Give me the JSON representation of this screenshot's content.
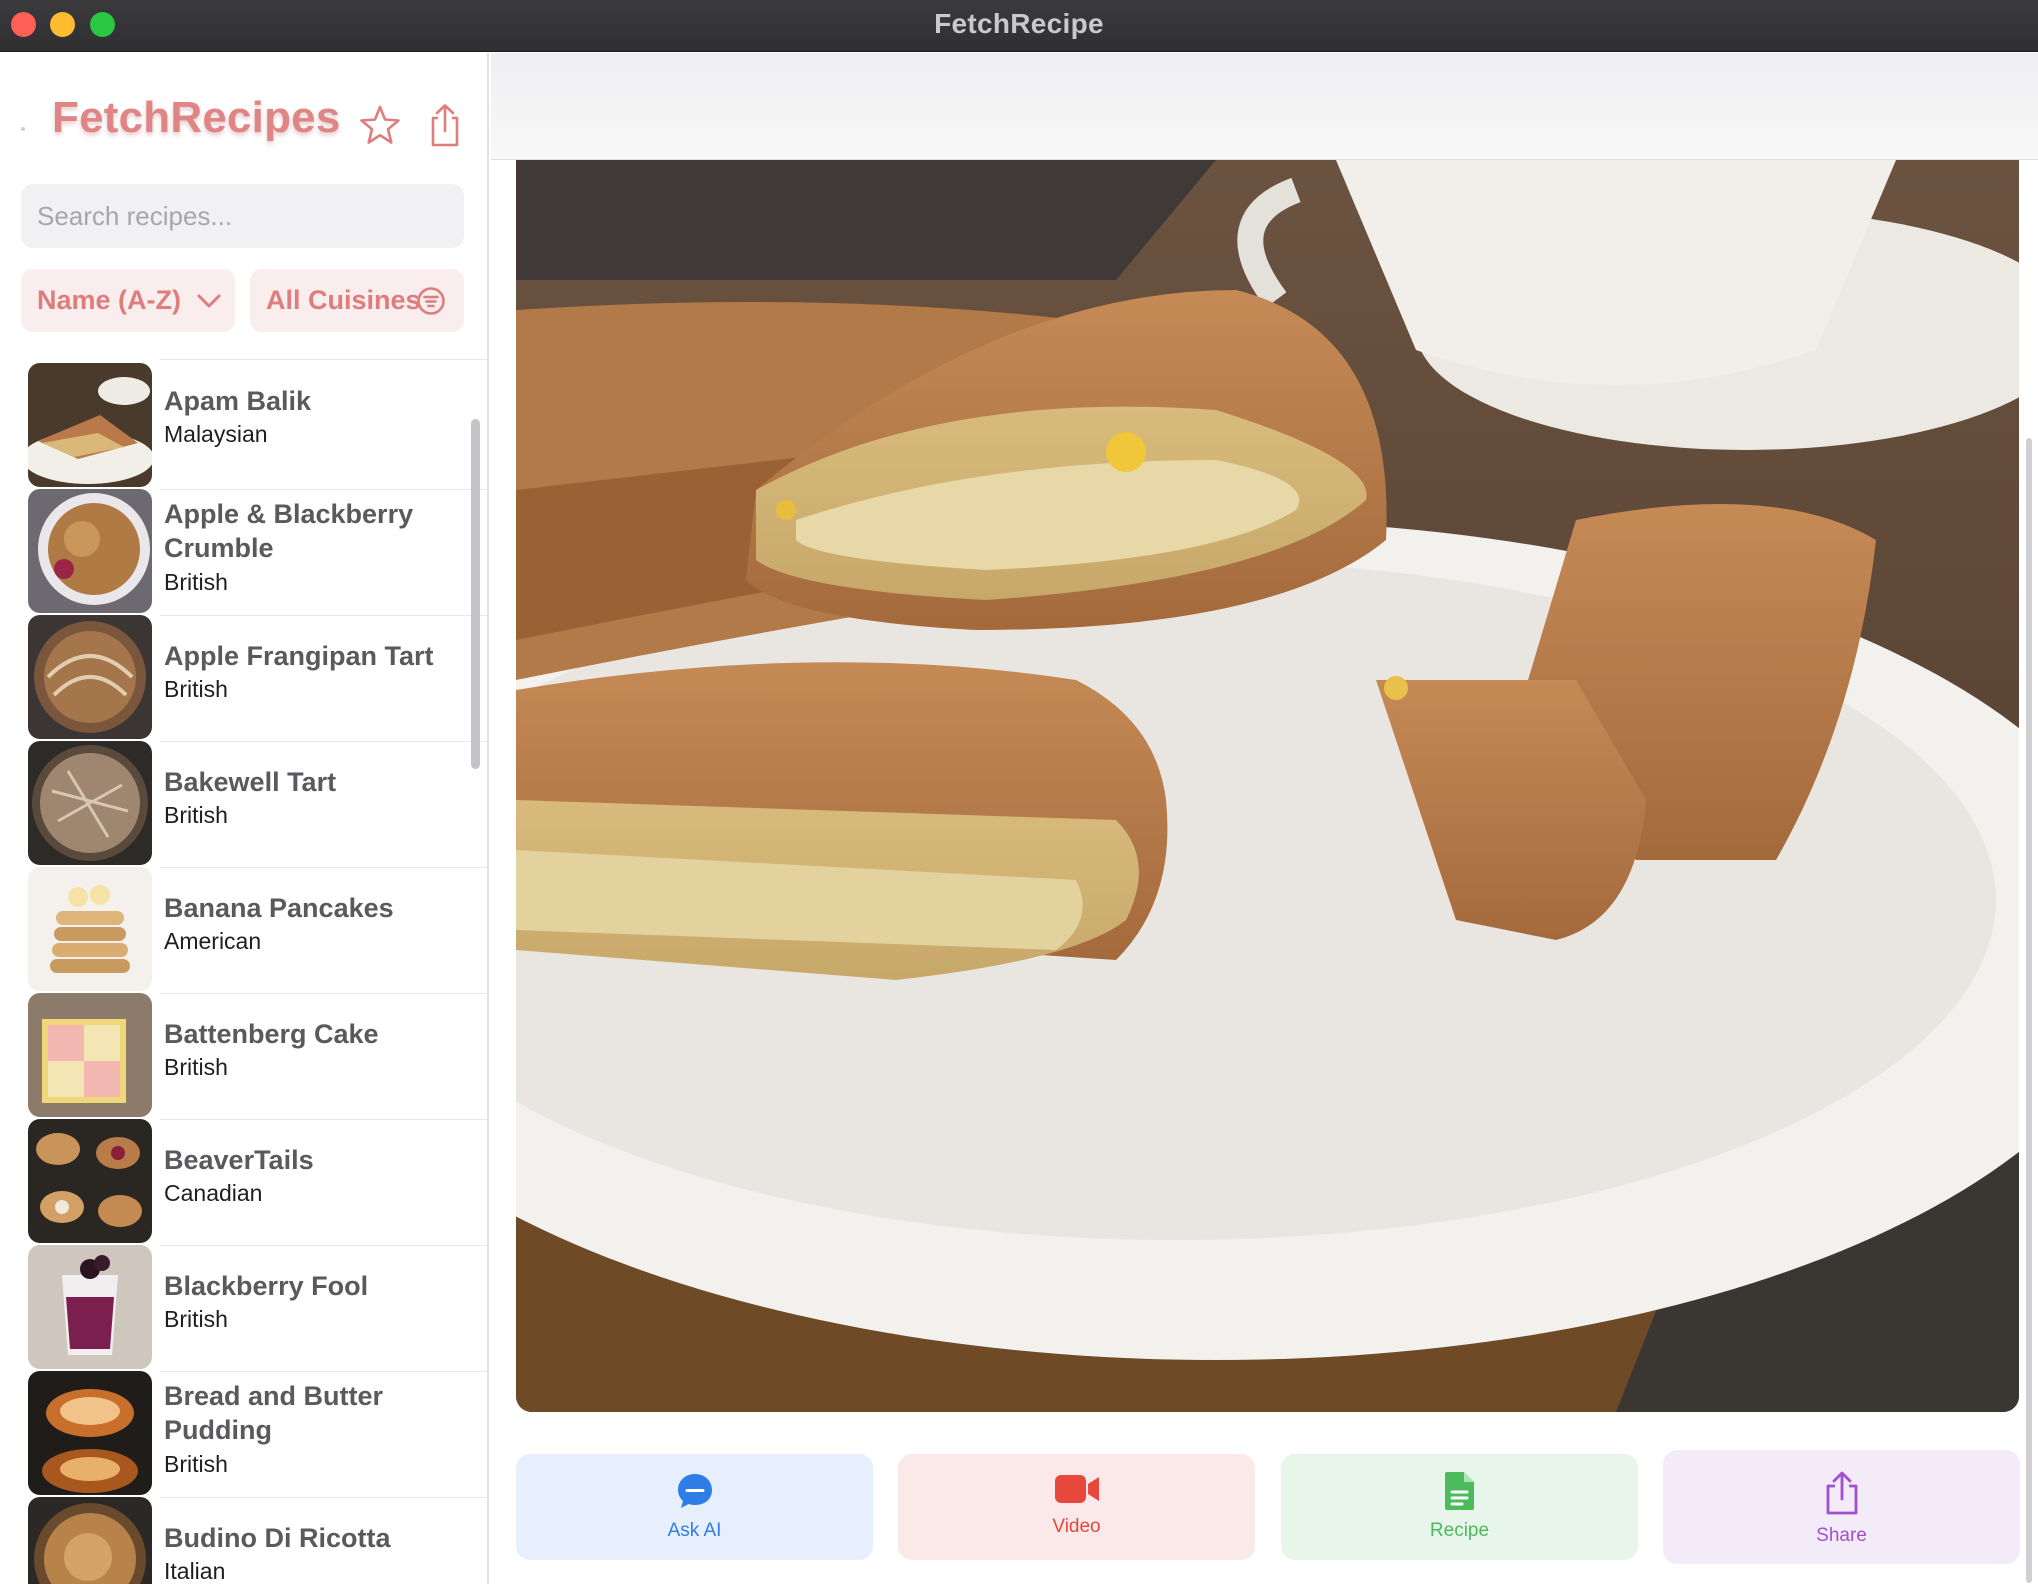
{
  "window": {
    "title": "FetchRecipe"
  },
  "sidebar": {
    "brand": "FetchRecipes",
    "search": {
      "placeholder": "Search recipes...",
      "value": ""
    },
    "sort_label": "Name (A-Z)",
    "cuisine_filter_label": "All Cuisines",
    "recipes": [
      {
        "name": "Apam Balik",
        "cuisine": "Malaysian"
      },
      {
        "name": "Apple & Blackberry Crumble",
        "cuisine": "British"
      },
      {
        "name": "Apple Frangipan Tart",
        "cuisine": "British"
      },
      {
        "name": "Bakewell Tart",
        "cuisine": "British"
      },
      {
        "name": "Banana Pancakes",
        "cuisine": "American"
      },
      {
        "name": "Battenberg Cake",
        "cuisine": "British"
      },
      {
        "name": "BeaverTails",
        "cuisine": "Canadian"
      },
      {
        "name": "Blackberry Fool",
        "cuisine": "British"
      },
      {
        "name": "Bread and Butter Pudding",
        "cuisine": "British"
      },
      {
        "name": "Budino Di Ricotta",
        "cuisine": "Italian"
      }
    ]
  },
  "actions": {
    "ask_ai": "Ask AI",
    "video": "Video",
    "recipe": "Recipe",
    "share": "Share"
  },
  "colors": {
    "brand": "#e08585",
    "ask_ai": "#2f7ee6",
    "video": "#e8473c",
    "recipe": "#4cbb5c",
    "share": "#a24fd0"
  },
  "icons": [
    "star-icon",
    "share-icon",
    "chevron-down-icon",
    "filter-icon",
    "chat-bubble-icon",
    "video-camera-icon",
    "document-icon",
    "share-icon"
  ]
}
